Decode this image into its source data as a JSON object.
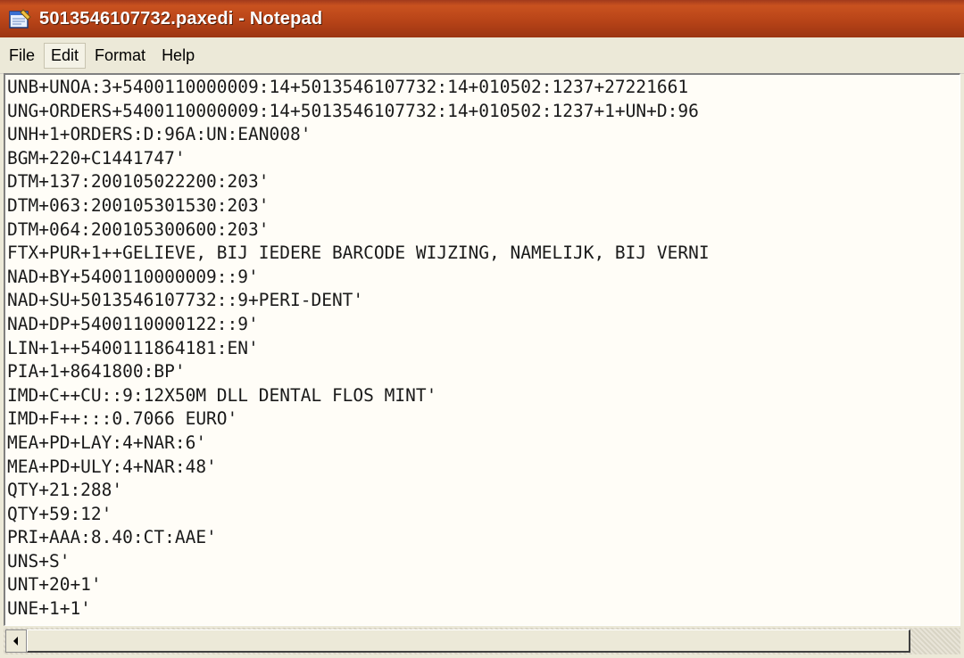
{
  "window": {
    "title": "5013546107732.paxedi - Notepad"
  },
  "menu": [
    "File",
    "Edit",
    "Format",
    "Help"
  ],
  "menu_active_index": 1,
  "colors": {
    "titlebar": "#b84418",
    "editor_background": "#fffdf7"
  },
  "icons": {
    "app": "notepad-icon",
    "scroll_left": "arrow-left-icon"
  },
  "lines": [
    "UNB+UNOA:3+5400110000009:14+5013546107732:14+010502:1237+27221661",
    "UNG+ORDERS+5400110000009:14+5013546107732:14+010502:1237+1+UN+D:96",
    "UNH+1+ORDERS:D:96A:UN:EAN008'",
    "BGM+220+C1441747'",
    "DTM+137:200105022200:203'",
    "DTM+063:200105301530:203'",
    "DTM+064:200105300600:203'",
    "FTX+PUR+1++GELIEVE, BIJ IEDERE BARCODE WIJZING, NAMELIJK, BIJ VERNI",
    "NAD+BY+5400110000009::9'",
    "NAD+SU+5013546107732::9+PERI-DENT'",
    "NAD+DP+5400110000122::9'",
    "LIN+1++5400111864181:EN'",
    "PIA+1+8641800:BP'",
    "IMD+C++CU::9:12X50M DLL DENTAL FLOS MINT'",
    "IMD+F++:::0.7066 EURO'",
    "MEA+PD+LAY:4+NAR:6'",
    "MEA+PD+ULY:4+NAR:48'",
    "QTY+21:288'",
    "QTY+59:12'",
    "PRI+AAA:8.40:CT:AAE'",
    "UNS+S'",
    "UNT+20+1'",
    "UNE+1+1'"
  ]
}
